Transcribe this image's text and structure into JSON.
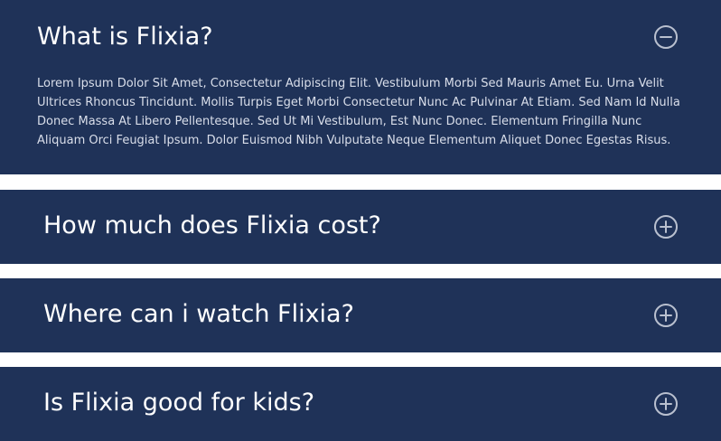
{
  "faq": {
    "items": [
      {
        "question": "What is Flixia?",
        "expanded": true,
        "toggle_icon": "minus-circle-icon",
        "answer": "Lorem Ipsum Dolor Sit Amet, Consectetur Adipiscing Elit. Vestibulum Morbi Sed Mauris Amet Eu. Urna Velit Ultrices Rhoncus Tincidunt. Mollis Turpis Eget Morbi Consectetur Nunc Ac Pulvinar At Etiam. Sed Nam Id Nulla Donec Massa At Libero Pellentesque. Sed Ut Mi Vestibulum, Est Nunc Donec. Elementum Fringilla Nunc Aliquam Orci Feugiat Ipsum. Dolor Euismod Nibh Vulputate Neque Elementum Aliquet Donec Egestas Risus."
      },
      {
        "question": "How much does Flixia cost?",
        "expanded": false,
        "toggle_icon": "plus-circle-icon"
      },
      {
        "question": "Where can i watch Flixia?",
        "expanded": false,
        "toggle_icon": "plus-circle-icon"
      },
      {
        "question": "Is Flixia good for kids?",
        "expanded": false,
        "toggle_icon": "plus-circle-icon"
      }
    ]
  },
  "colors": {
    "panel_background": "#1f3258",
    "page_background": "#ffffff",
    "question_text": "#ffffff",
    "answer_text": "#d9deea",
    "icon_stroke": "#b9c0cf"
  }
}
